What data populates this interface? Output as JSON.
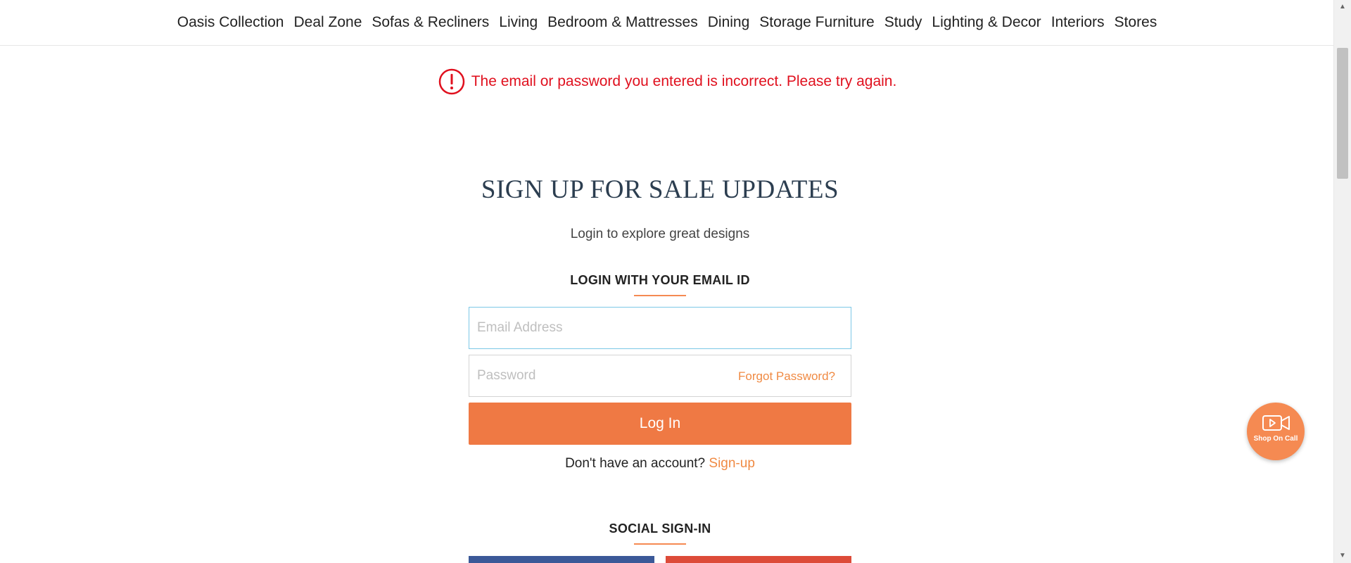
{
  "nav": {
    "items": [
      "Oasis Collection",
      "Deal Zone",
      "Sofas & Recliners",
      "Living",
      "Bedroom & Mattresses",
      "Dining",
      "Storage Furniture",
      "Study",
      "Lighting & Decor",
      "Interiors",
      "Stores"
    ]
  },
  "error": {
    "message": "The email or password you entered is incorrect. Please try again.",
    "icon": "exclamation-circle-icon",
    "color": "#e0101e"
  },
  "form": {
    "title": "SIGN UP FOR SALE UPDATES",
    "subtitle": "Login to explore great designs",
    "email_heading": "LOGIN WITH YOUR EMAIL ID",
    "email_placeholder": "Email Address",
    "email_value": "",
    "password_placeholder": "Password",
    "password_value": "",
    "forgot_label": "Forgot Password?",
    "login_label": "Log In",
    "no_account_text": "Don't have an account?",
    "signup_label": "Sign-up",
    "social_heading": "SOCIAL SIGN-IN"
  },
  "widget": {
    "label": "Shop On Call",
    "icon": "video-camera-icon"
  },
  "colors": {
    "accent": "#ef7944",
    "link": "#f08a43",
    "title": "#2c3e50",
    "facebook": "#3b5998",
    "google": "#dd4b39"
  }
}
